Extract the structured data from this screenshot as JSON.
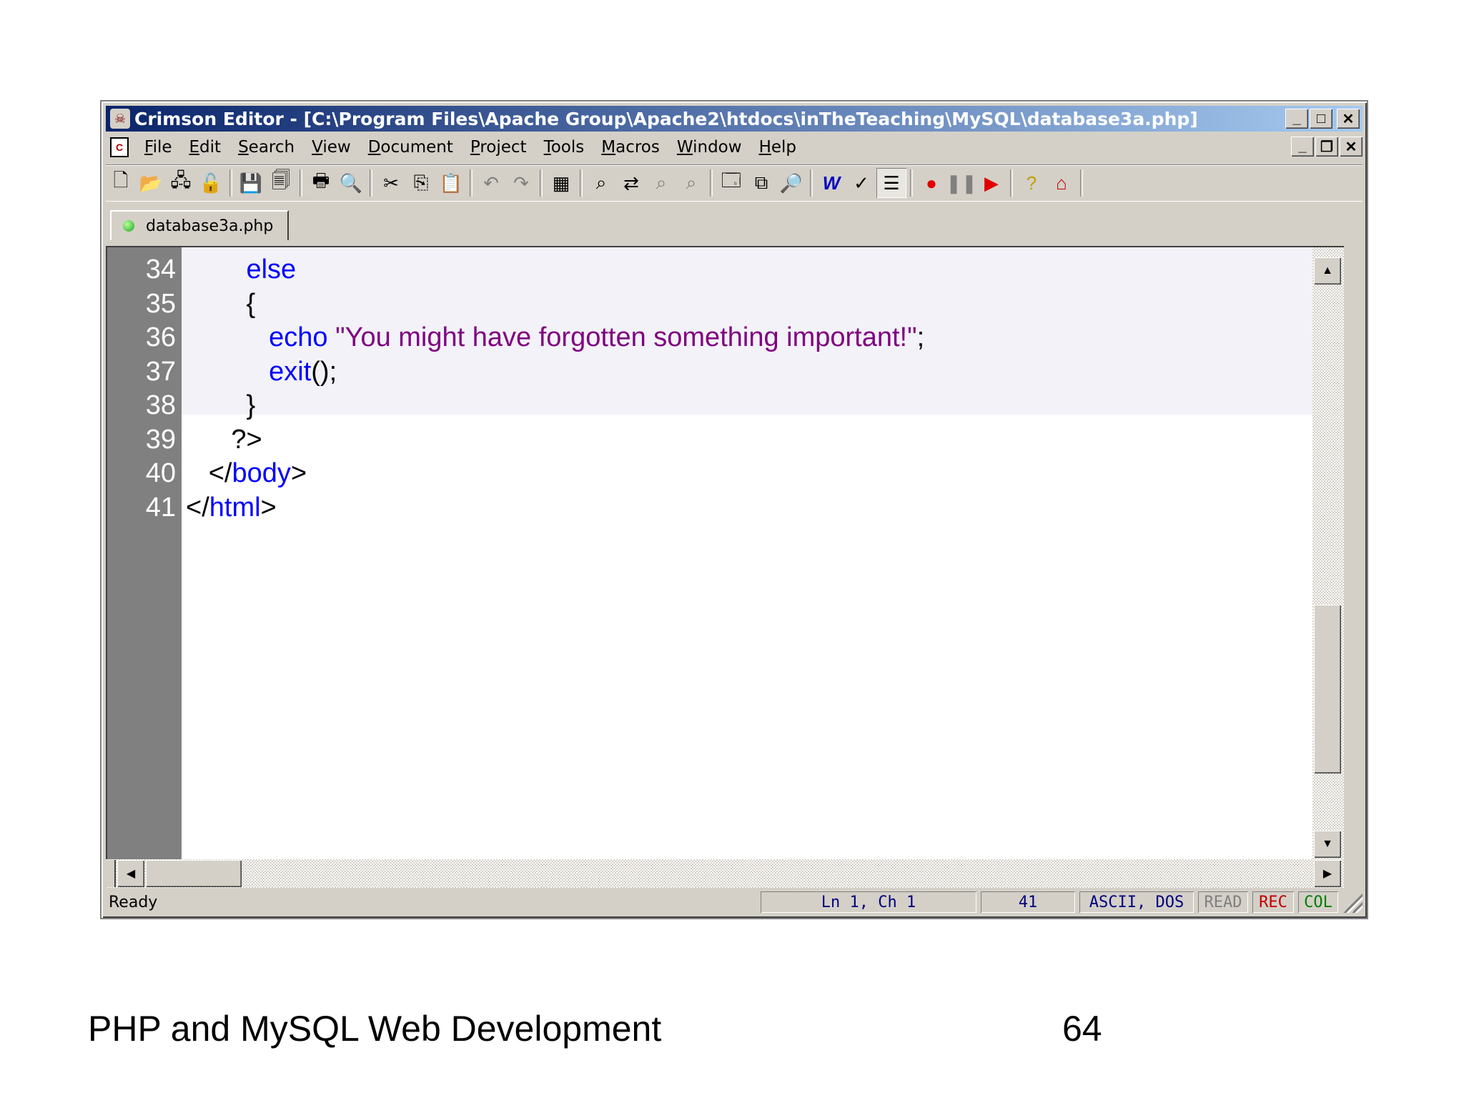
{
  "window": {
    "title": "Crimson Editor - [C:\\Program Files\\Apache Group\\Apache2\\htdocs\\inTheTeaching\\MySQL\\database3a.php]"
  },
  "menu": [
    {
      "u": "F",
      "rest": "ile"
    },
    {
      "u": "E",
      "rest": "dit"
    },
    {
      "u": "S",
      "rest": "earch"
    },
    {
      "u": "V",
      "rest": "iew"
    },
    {
      "u": "D",
      "rest": "ocument"
    },
    {
      "u": "P",
      "rest": "roject"
    },
    {
      "u": "T",
      "rest": "ools"
    },
    {
      "u": "M",
      "rest": "acros"
    },
    {
      "u": "W",
      "rest": "indow"
    },
    {
      "u": "H",
      "rest": "elp"
    }
  ],
  "tab": {
    "label": "database3a.php"
  },
  "code_lines": [
    {
      "n": "34",
      "indent": "        ",
      "parts": [
        [
          "kw",
          "else"
        ]
      ]
    },
    {
      "n": "35",
      "indent": "        ",
      "parts": [
        [
          "pn",
          "{"
        ]
      ]
    },
    {
      "n": "36",
      "indent": "           ",
      "parts": [
        [
          "kw",
          "echo "
        ],
        [
          "str",
          "\"You might have forgotten something important!\""
        ],
        [
          "pn",
          ";"
        ]
      ]
    },
    {
      "n": "37",
      "indent": "           ",
      "parts": [
        [
          "kw",
          "exit"
        ],
        [
          "pn",
          "();"
        ]
      ]
    },
    {
      "n": "38",
      "indent": "        ",
      "parts": [
        [
          "pn",
          "}"
        ]
      ]
    },
    {
      "n": "39",
      "indent": "      ",
      "parts": [
        [
          "pn",
          "?>"
        ]
      ]
    },
    {
      "n": "40",
      "indent": "   ",
      "parts": [
        [
          "pn",
          "</"
        ],
        [
          "kw",
          "body"
        ],
        [
          "pn",
          ">"
        ]
      ]
    },
    {
      "n": "41",
      "indent": "",
      "parts": [
        [
          "pn",
          "</"
        ],
        [
          "kw",
          "html"
        ],
        [
          "pn",
          ">"
        ]
      ]
    }
  ],
  "status": {
    "text": "Ready",
    "position": "Ln 1, Ch 1",
    "lines": "41",
    "encoding": "ASCII, DOS",
    "read": "READ",
    "rec": "REC",
    "col": "COL"
  },
  "colors": {
    "keyword": "#0000ff",
    "string": "#800080",
    "read": "#808080",
    "rec": "#c00000",
    "col": "#008000"
  },
  "slide": {
    "footer": "PHP and MySQL Web Development",
    "page": "64"
  }
}
